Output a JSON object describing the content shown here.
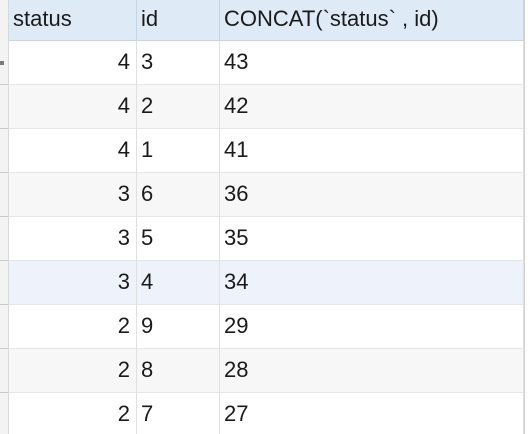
{
  "columns": [
    "status",
    "id",
    "CONCAT(`status` , id)"
  ],
  "rows": [
    {
      "status": "4",
      "id": "3",
      "concat": "43"
    },
    {
      "status": "4",
      "id": "2",
      "concat": "42"
    },
    {
      "status": "4",
      "id": "1",
      "concat": "41"
    },
    {
      "status": "3",
      "id": "6",
      "concat": "36"
    },
    {
      "status": "3",
      "id": "5",
      "concat": "35"
    },
    {
      "status": "3",
      "id": "4",
      "concat": "34"
    },
    {
      "status": "2",
      "id": "9",
      "concat": "29"
    },
    {
      "status": "2",
      "id": "8",
      "concat": "28"
    },
    {
      "status": "2",
      "id": "7",
      "concat": "27"
    }
  ]
}
